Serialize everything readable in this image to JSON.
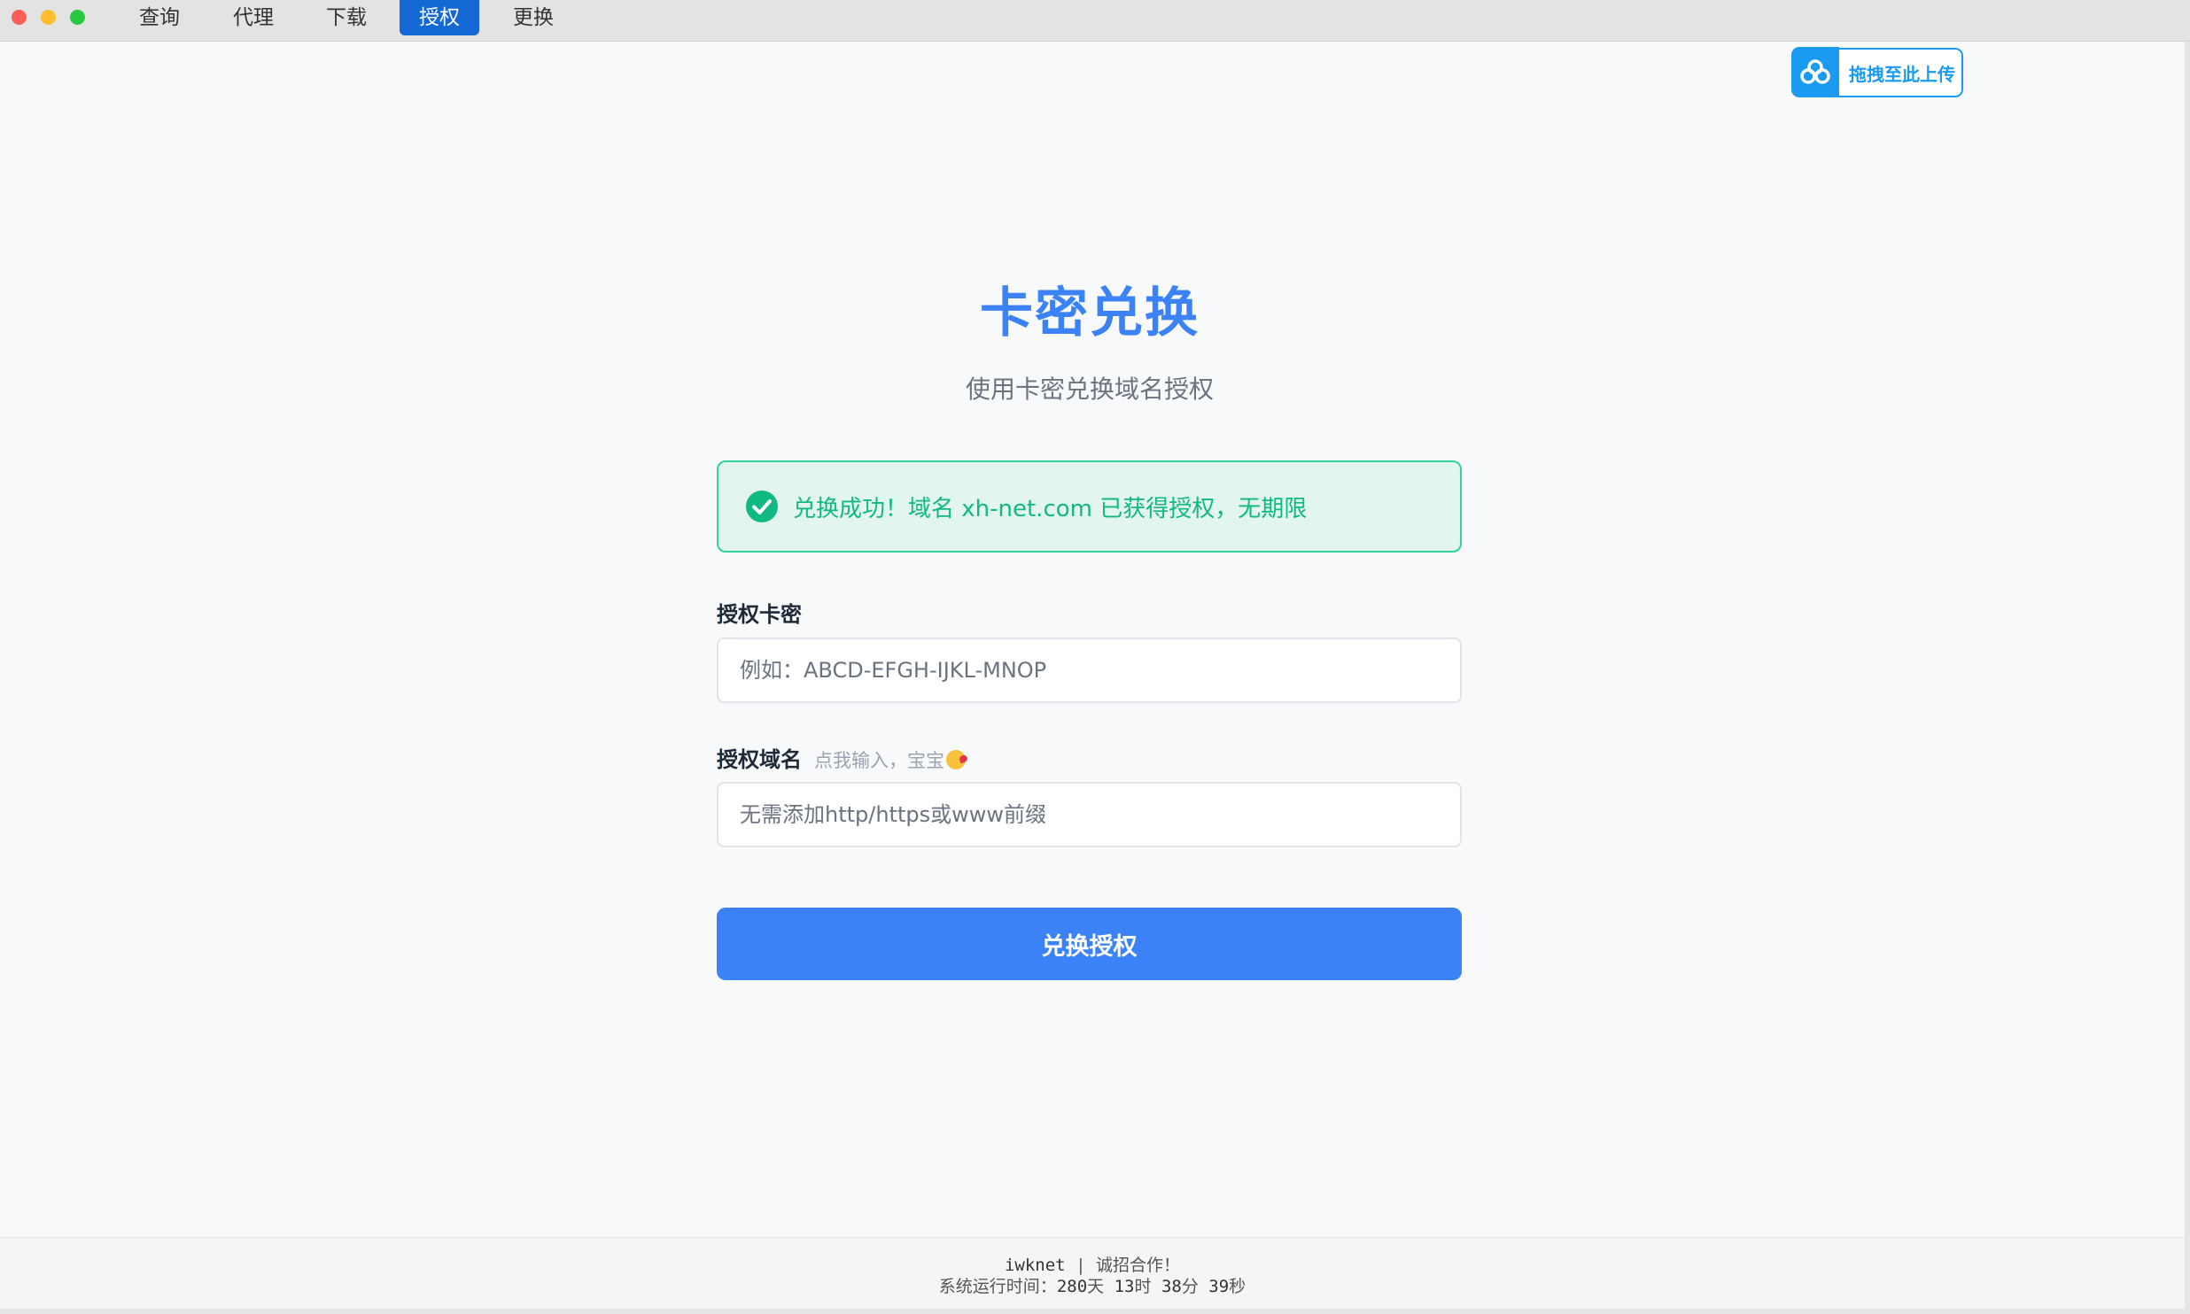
{
  "nav": {
    "tabs": [
      {
        "label": "查询"
      },
      {
        "label": "代理"
      },
      {
        "label": "下载"
      },
      {
        "label": "授权"
      },
      {
        "label": "更换"
      }
    ],
    "active_tab": "授权"
  },
  "upload_widget": {
    "label": "拖拽至此上传",
    "icon": "cloud-upload-icon"
  },
  "page": {
    "title": "卡密兑换",
    "subtitle": "使用卡密兑换域名授权"
  },
  "alert": {
    "message": "兑换成功！域名 xh-net.com 已获得授权，无期限",
    "icon": "check-circle-icon"
  },
  "form": {
    "card_label": "授权卡密",
    "card_placeholder": "例如：ABCD-EFGH-IJKL-MNOP",
    "domain_label": "授权域名",
    "domain_hint": "点我输入，宝宝",
    "domain_placeholder": "无需添加http/https或www前缀",
    "submit_label": "兑换授权"
  },
  "footer": {
    "brand": "iwknet",
    "slogan": "诚招合作！",
    "uptime_prefix": "系统运行时间：",
    "days": "280",
    "hours": "13",
    "minutes": "38",
    "seconds": "39"
  },
  "colors": {
    "accent": "#3b82f6",
    "active_tab": "#1468d4",
    "success": "#10b981",
    "upload": "#1a9af0"
  }
}
